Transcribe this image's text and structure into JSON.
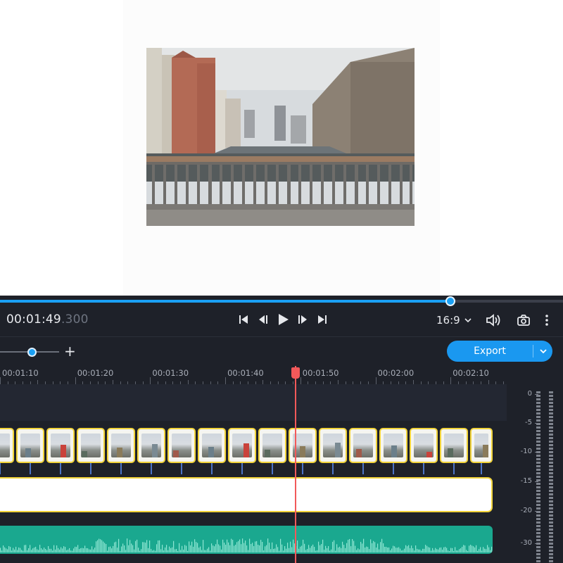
{
  "player": {
    "timecode_main": "00:01:49",
    "timecode_ms": ".300",
    "aspect_ratio": "16:9",
    "scrub_progress": 0.8
  },
  "toolbar": {
    "export_label": "Export"
  },
  "ruler": {
    "labels": [
      "00:01:10",
      "00:01:20",
      "00:01:30",
      "00:01:40",
      "00:01:50",
      "00:02:00",
      "00:02:10"
    ]
  },
  "meter": {
    "labels": [
      "0",
      "-5",
      "-10",
      "-15",
      "-20",
      "-30"
    ]
  },
  "colors": {
    "accent": "#1aa0f4",
    "playhead": "#f2595a",
    "clip_border": "#f2d43a",
    "audio": "#1aa88f",
    "panel": "#1e2129"
  },
  "icons": {
    "skip_start": "skip-to-start-icon",
    "prev_frame": "previous-frame-icon",
    "play": "play-icon",
    "next_frame": "next-frame-icon",
    "skip_end": "skip-to-end-icon",
    "volume": "volume-icon",
    "snapshot": "camera-icon",
    "more": "more-vertical-icon",
    "zoom_in": "plus-icon",
    "chevron": "chevron-down-icon"
  }
}
